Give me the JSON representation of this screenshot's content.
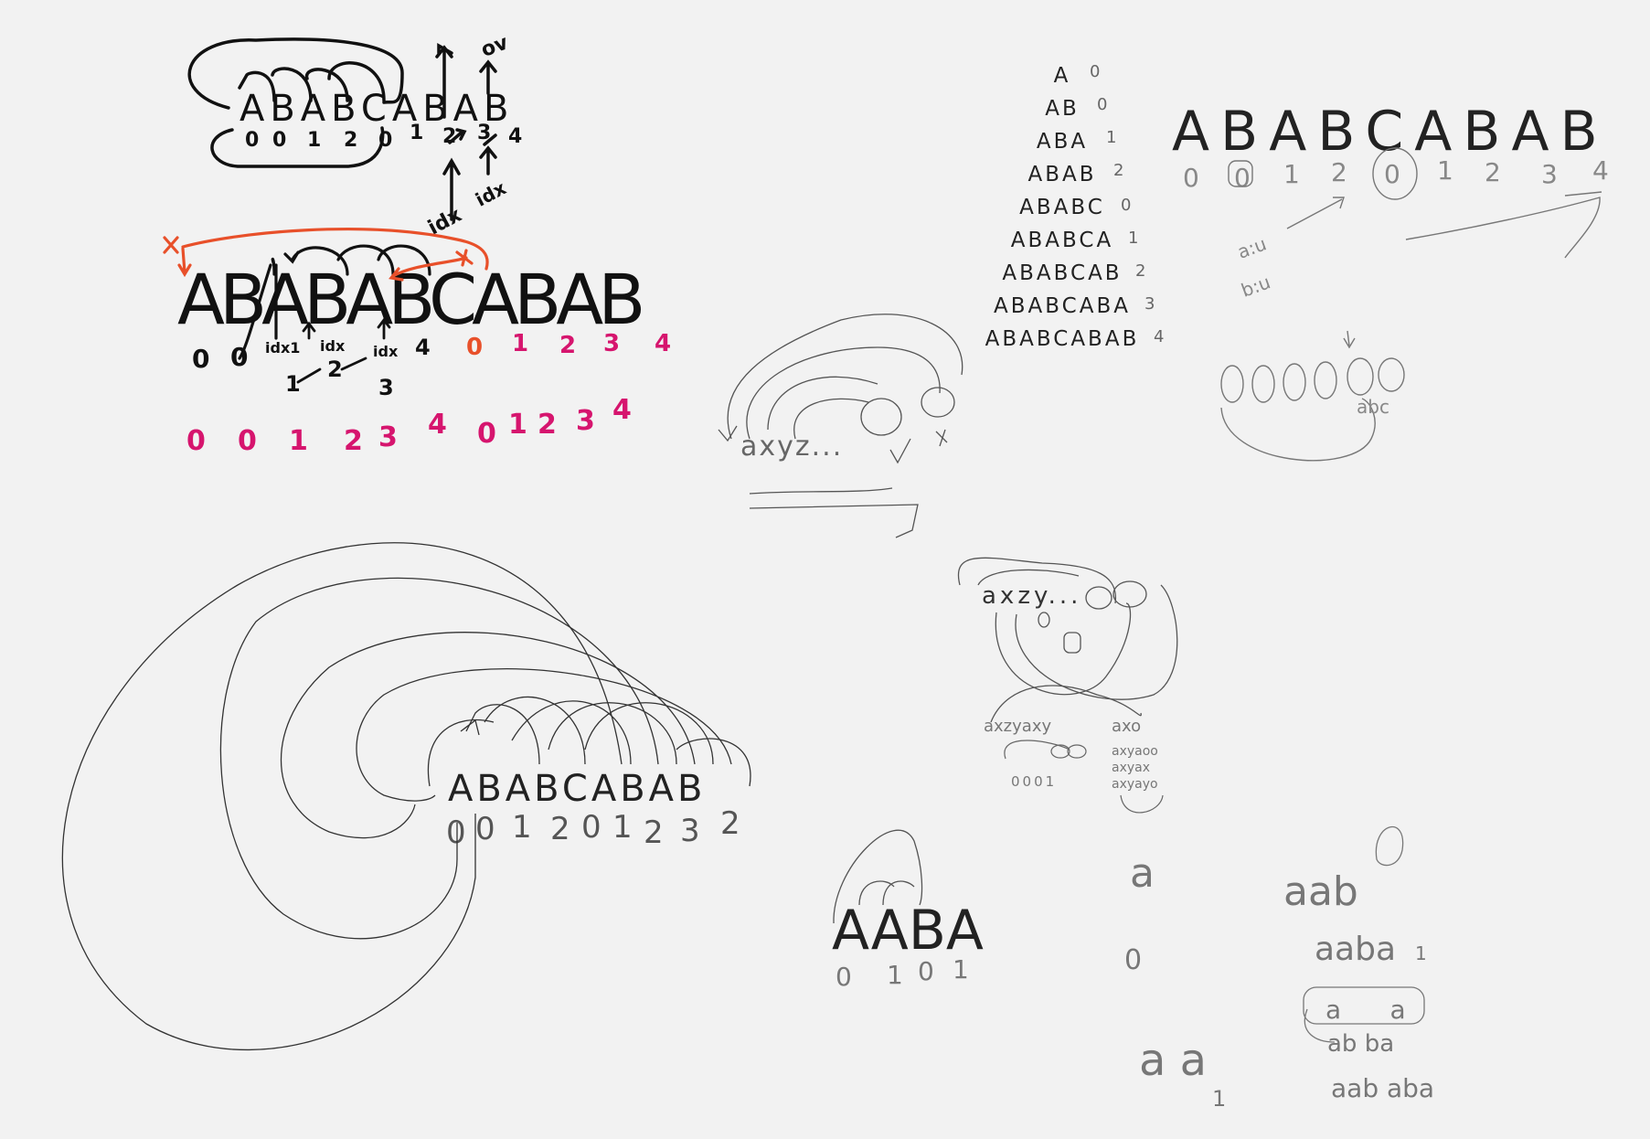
{
  "colors": {
    "background": "#f2f2f2",
    "ink_dark": "#111111",
    "ink_thin": "#555555",
    "ink_orange": "#e8502a",
    "ink_magenta": "#d6156e"
  },
  "top_left": {
    "string": "ABABCABAB",
    "indices": [
      "0",
      "0",
      "1",
      "2",
      "0",
      "1",
      "2",
      "3",
      "4"
    ],
    "annot_ov": "ov",
    "annot_idx_1": "idx",
    "annot_idx_2": "idx"
  },
  "mid_left": {
    "string": "ABABABCABAB",
    "indices_black": [
      "0",
      "0"
    ],
    "idx_labels": [
      "idx1",
      "idx",
      "idx"
    ],
    "steps": [
      "1",
      "2",
      "3",
      "4"
    ],
    "indices_orange": [
      "0",
      "1",
      "2",
      "3",
      "4"
    ],
    "indices_magenta": [
      "0",
      "0",
      "1",
      "2",
      "3",
      "4",
      "0",
      "1",
      "2",
      "3",
      "4"
    ]
  },
  "prefix_table": {
    "rows": [
      "A",
      "AB",
      "ABA",
      "ABAB",
      "ABABC",
      "ABABCA",
      "ABABCAB",
      "ABABCABA",
      "ABABCABAB"
    ],
    "values": [
      "0",
      "0",
      "1",
      "2",
      "0",
      "1",
      "2",
      "3",
      "4"
    ]
  },
  "top_right": {
    "string": "ABABCABAB",
    "indices": [
      "0",
      "0",
      "1",
      "2",
      "0",
      "1",
      "2",
      "3",
      "4"
    ],
    "annot_a": "a:u",
    "annot_b": "b:u",
    "annot_abc": "abc"
  },
  "middle_sketch": {
    "text": "axyz..."
  },
  "center_sketch": {
    "text": "axzy...",
    "left_sub": "axzyaxy",
    "left_idx": "0001",
    "right_sub": "axo",
    "right_rows": [
      "axyaoo",
      "axyax",
      "axyayo"
    ]
  },
  "bottom_left": {
    "string": "ABABCABAB",
    "indices": [
      "0",
      "0",
      "1",
      "2",
      "0",
      "1",
      "2",
      "3",
      "2"
    ]
  },
  "aaba": {
    "string": "AABA",
    "indices": [
      "0",
      "1",
      "0",
      "1"
    ]
  },
  "bottom_right": {
    "a_left": "a",
    "zero_left": "0",
    "aa_text": "a a",
    "aa_idx": "1",
    "aab_text": "aab",
    "aaba_text": "aaba",
    "aaba_idx": "1",
    "boxed_text": "a      a",
    "ab_ba": "ab ba",
    "aab_aba": "aab aba"
  }
}
